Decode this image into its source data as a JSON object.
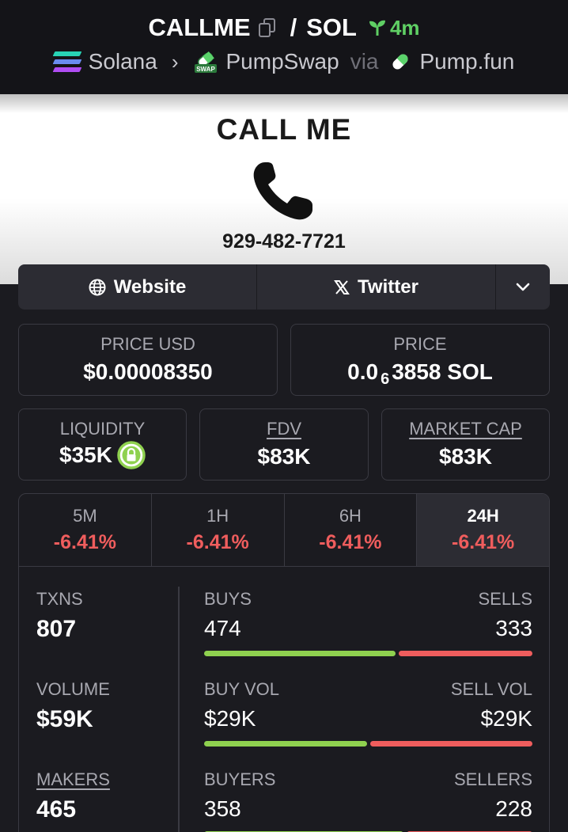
{
  "header": {
    "token": "CALLME",
    "separator": "/",
    "quote": "SOL",
    "age": "4m",
    "chain": "Solana",
    "dex": "PumpSwap",
    "dex_badge": "SWAP",
    "via": "via",
    "launchpad": "Pump.fun"
  },
  "banner": {
    "title": "CALL ME",
    "phone": "929-482-7721"
  },
  "links": {
    "website": "Website",
    "twitter": "Twitter"
  },
  "price": {
    "usd_label": "PRICE USD",
    "usd_value": "$0.00008350",
    "native_label": "PRICE",
    "native_prefix": "0.0",
    "native_zeros": "6",
    "native_digits": "3858 SOL"
  },
  "stats": {
    "liquidity_label": "LIQUIDITY",
    "liquidity_value": "$35K",
    "fdv_label": "FDV",
    "fdv_value": "$83K",
    "mcap_label": "MARKET CAP",
    "mcap_value": "$83K"
  },
  "timeframes": [
    {
      "label": "5M",
      "change": "-6.41%"
    },
    {
      "label": "1H",
      "change": "-6.41%"
    },
    {
      "label": "6H",
      "change": "-6.41%"
    },
    {
      "label": "24H",
      "change": "-6.41%",
      "active": true
    }
  ],
  "metrics": {
    "txns_label": "TXNS",
    "txns_value": "807",
    "volume_label": "VOLUME",
    "volume_value": "$59K",
    "makers_label": "MAKERS",
    "makers_value": "465"
  },
  "splits": {
    "buys_label": "BUYS",
    "buys_value": "474",
    "sells_label": "SELLS",
    "sells_value": "333",
    "buyvol_label": "BUY VOL",
    "buyvol_value": "$29K",
    "sellvol_label": "SELL VOL",
    "sellvol_value": "$29K",
    "buyers_label": "BUYERS",
    "buyers_value": "358",
    "sellers_label": "SELLERS",
    "sellers_value": "228",
    "buy_share": 0.587,
    "buyvol_share": 0.5,
    "buyers_share": 0.611
  },
  "colors": {
    "positive": "#8fd14f",
    "negative": "#ef5d5d",
    "age": "#5fcf64"
  }
}
